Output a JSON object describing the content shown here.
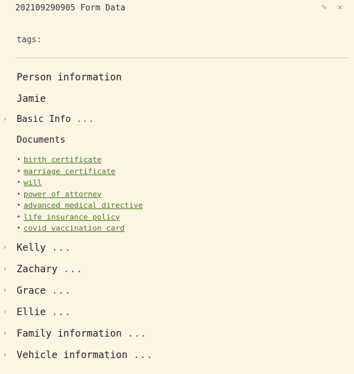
{
  "window": {
    "title": "202109290905 Form Data"
  },
  "tags_label": "tags:",
  "sections": {
    "person_information": "Person information",
    "jamie": "Jamie",
    "basic_info": "Basic Info",
    "documents": "Documents",
    "kelly": "Kelly",
    "zachary": "Zachary",
    "grace": "Grace",
    "ellie": "Ellie",
    "family_information": "Family information",
    "vehicle_information": "Vehicle information"
  },
  "ellipsis": "...",
  "documents": [
    "birth certificate",
    "marriage certificate",
    "will",
    "power of attorney",
    "advanced medical directive",
    "life insurance policy",
    "covid vaccination card"
  ],
  "icons": {
    "edit": "pencil-icon",
    "close": "close-icon",
    "collapse": "chevron-right-icon"
  },
  "colors": {
    "background": "#fcf5e4",
    "link": "#4a7a2c"
  }
}
